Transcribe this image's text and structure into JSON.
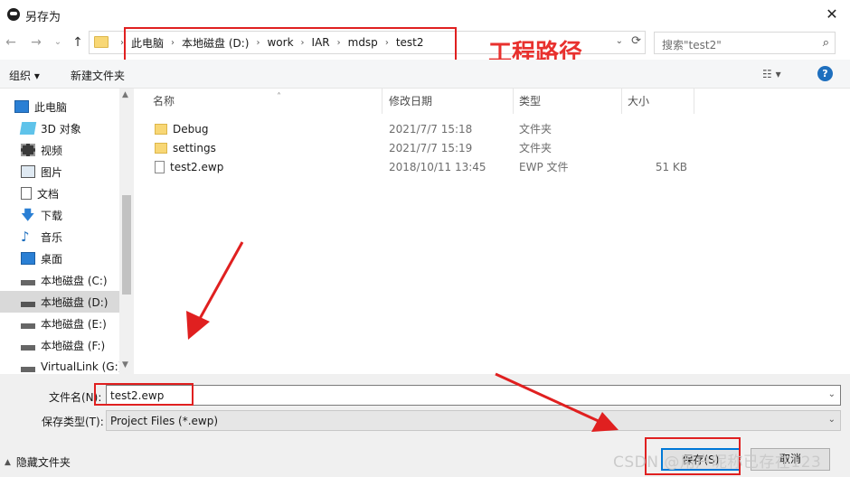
{
  "window": {
    "title": "另存为",
    "close_glyph": "✕"
  },
  "nav": {
    "back": "←",
    "forward": "→",
    "dropdown": "⌄",
    "up": "↑"
  },
  "address": {
    "crumbs": [
      "此电脑",
      "本地磁盘 (D:)",
      "work",
      "IAR",
      "mdsp",
      "test2"
    ],
    "separator": "›",
    "dropdown": "⌄",
    "refresh": "⟳"
  },
  "annotation": {
    "text": "工程路径",
    "color": "#e8312e"
  },
  "search": {
    "placeholder": "搜索\"test2\"",
    "icon": "⌕"
  },
  "toolbar": {
    "organize": "组织 ▾",
    "new_folder": "新建文件夹",
    "view": "☷ ▾",
    "help": "?"
  },
  "sidebar": {
    "items": [
      {
        "label": "此电脑",
        "icon": "computer-icon"
      },
      {
        "label": "3D 对象",
        "icon": "cube-icon"
      },
      {
        "label": "视频",
        "icon": "video-icon"
      },
      {
        "label": "图片",
        "icon": "picture-icon"
      },
      {
        "label": "文档",
        "icon": "document-icon"
      },
      {
        "label": "下载",
        "icon": "download-icon"
      },
      {
        "label": "音乐",
        "icon": "music-icon"
      },
      {
        "label": "桌面",
        "icon": "desktop-icon"
      },
      {
        "label": "本地磁盘 (C:)",
        "icon": "drive-icon"
      },
      {
        "label": "本地磁盘 (D:)",
        "icon": "drive-icon",
        "selected": true
      },
      {
        "label": "本地磁盘 (E:)",
        "icon": "drive-icon"
      },
      {
        "label": "本地磁盘 (F:)",
        "icon": "drive-icon"
      },
      {
        "label": "VirtualLink (G:)",
        "icon": "drive-icon"
      }
    ]
  },
  "columns": {
    "name": "名称",
    "modified": "修改日期",
    "type": "类型",
    "size": "大小"
  },
  "files": [
    {
      "name": "Debug",
      "modified": "2021/7/7 15:18",
      "type": "文件夹",
      "size": "",
      "kind": "folder"
    },
    {
      "name": "settings",
      "modified": "2021/7/7 15:19",
      "type": "文件夹",
      "size": "",
      "kind": "folder"
    },
    {
      "name": "test2.ewp",
      "modified": "2018/10/11 13:45",
      "type": "EWP 文件",
      "size": "51 KB",
      "kind": "file"
    }
  ],
  "form": {
    "filename_label": "文件名(N):",
    "filename_value": "test2.ewp",
    "filetype_label": "保存类型(T):",
    "filetype_value": "Project Files (*.ewp)",
    "save_label": "保存(S)",
    "cancel_label": "取消",
    "hide_folders": "隐藏文件夹"
  },
  "watermark": "CSDN @用户昵称已存在123"
}
